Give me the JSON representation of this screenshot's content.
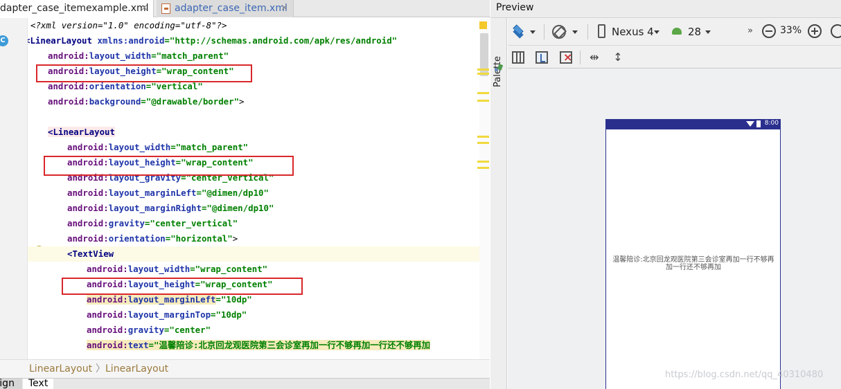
{
  "editor": {
    "tabs": [
      {
        "label": "dapter_case_itemexample.xml",
        "close": "×"
      },
      {
        "label": "adapter_case_item.xml",
        "close": "×"
      }
    ],
    "gutter_badge": "C",
    "code": {
      "l1_pi": "<?xml version=\"1.0\" encoding=\"utf-8\"?>",
      "l2_tag": "<LinearLayout",
      "l2_attr": " xmlns:android",
      "l2_val": "=\"http://schemas.android.com/apk/res/android\"",
      "l3_ns": "android:",
      "l3_attr": "layout_width",
      "l3_val": "=\"match_parent\"",
      "l4_ns": "android:",
      "l4_attr": "layout_height",
      "l4_val": "=\"wrap_content\"",
      "l5_ns": "android:",
      "l5_attr": "orientation",
      "l5_val": "=\"vertical\"",
      "l6_ns": "android:",
      "l6_attr": "background",
      "l6_val": "=\"@drawable/border\"",
      "l6_end": ">",
      "l8_tag": "<LinearLayout",
      "l9_ns": "android:",
      "l9_attr": "layout_width",
      "l9_val": "=\"match_parent\"",
      "l10_ns": "android:",
      "l10_attr": "layout_height",
      "l10_val": "=\"wrap_content\"",
      "l11_ns": "android:",
      "l11_attr": "layout_gravity",
      "l11_val": "=\"center_vertical\"",
      "l12_ns": "android:",
      "l12_attr": "layout_marginLeft",
      "l12_val": "=\"@dimen/dp10\"",
      "l13_ns": "android:",
      "l13_attr": "layout_marginRight",
      "l13_val": "=\"@dimen/dp10\"",
      "l14_ns": "android:",
      "l14_attr": "gravity",
      "l14_val": "=\"center_vertical\"",
      "l15_ns": "android:",
      "l15_attr": "orientation",
      "l15_val": "=\"horizontal\"",
      "l15_end": ">",
      "l16_tag": "<TextView",
      "l17_ns": "android:",
      "l17_attr": "layout_width",
      "l17_val": "=\"wrap_content\"",
      "l18_ns": "android:",
      "l18_attr": "layout_height",
      "l18_val": "=\"wrap_content\"",
      "l19_ns": "android:",
      "l19_attr": "layout_marginLeft",
      "l19_val": "=\"10dp\"",
      "l20_ns": "android:",
      "l20_attr": "layout_marginTop",
      "l20_val": "=\"10dp\"",
      "l21_ns": "android:",
      "l21_attr": "gravity",
      "l21_val": "=\"center\"",
      "l22_ns": "android:",
      "l22_attr": "text",
      "l22_val": "=\"温馨陪诊:北京回龙观医院第三会诊室再加一行不够再加一行还不够再加"
    },
    "breadcrumb": [
      "LinearLayout",
      "LinearLayout"
    ],
    "breadcrumb_sep": "〉",
    "bottom_tabs": [
      "sign",
      "Text"
    ]
  },
  "preview": {
    "title": "Preview",
    "palette_label": "Palette",
    "device": "Nexus 4",
    "api_level": "28",
    "more": "»",
    "zoom": "33%",
    "status_time": "8:00",
    "rendered_text": "温馨陪诊:北京回龙观医院第三会诊室再加一行不够再加一行还不够再加",
    "watermark": "https://blog.csdn.net/qq_40310480"
  },
  "colors": {
    "highlight_box": "#d9272a",
    "statusbar": "#2a2f8e",
    "attr_blue": "#1e34a8",
    "value_green": "#008000"
  }
}
